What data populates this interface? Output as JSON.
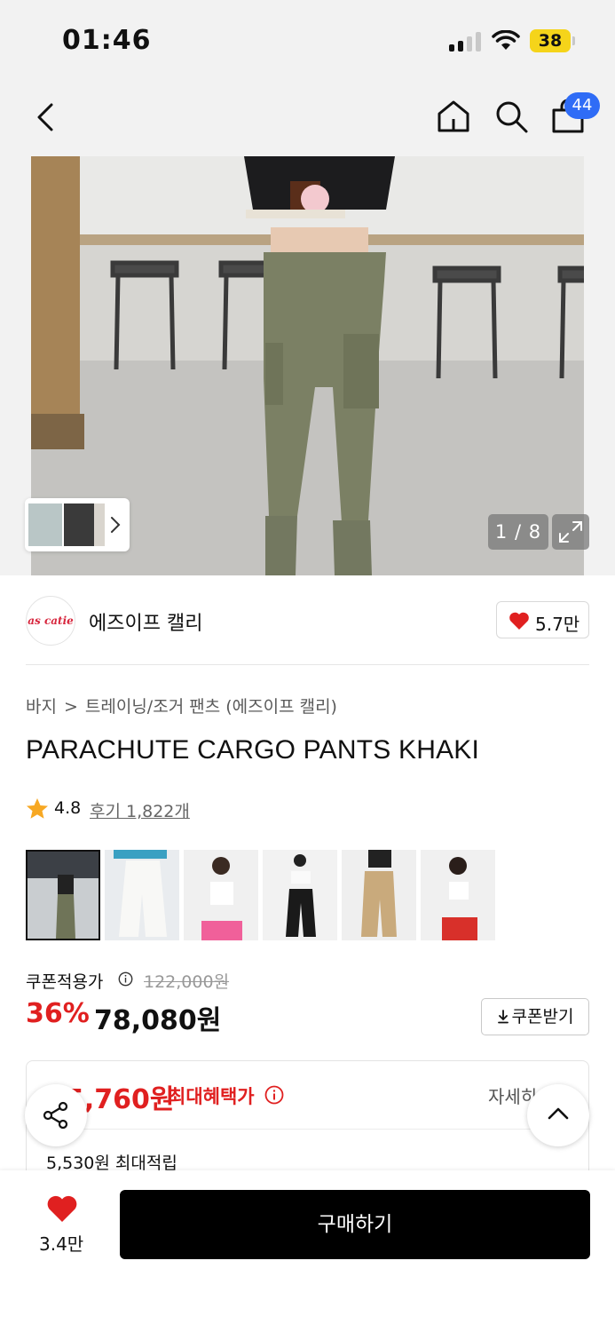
{
  "status_bar": {
    "time": "01:46",
    "battery": "38"
  },
  "nav": {
    "cart_count": "44"
  },
  "gallery": {
    "pager": "1 / 8"
  },
  "brand": {
    "logo_text": "as catie",
    "name": "에즈이프 캘리",
    "likes": "5.7만"
  },
  "breadcrumb": {
    "category": "바지",
    "separator": ">",
    "subcategory": "트레이닝/조거 팬츠 (에즈이프 캘리)"
  },
  "product": {
    "title": "PARACHUTE CARGO PANTS KHAKI"
  },
  "rating": {
    "score": "4.8",
    "reviews": "후기 1,822개"
  },
  "price": {
    "coupon_label": "쿠폰적용가",
    "original": "122,000원",
    "discount": "36%",
    "final": "78,080원",
    "coupon_button": "쿠폰받기"
  },
  "benefit": {
    "max_price": "5,760원",
    "max_label": "최대혜택가",
    "detail": "자세히",
    "points": "5,530원 최대적립"
  },
  "bottom_bar": {
    "like_count": "3.4만",
    "buy_label": "구매하기"
  },
  "colors": {
    "accent_red": "#e02020",
    "badge_blue": "#2f6cf6",
    "battery_yellow": "#f5d41a"
  },
  "icons": [
    "back-icon",
    "home-icon",
    "search-icon",
    "shopping-bag-icon",
    "heart-icon",
    "star-icon",
    "info-icon",
    "download-icon",
    "share-icon",
    "chevron-up-icon",
    "expand-icon",
    "chevron-right-icon"
  ]
}
